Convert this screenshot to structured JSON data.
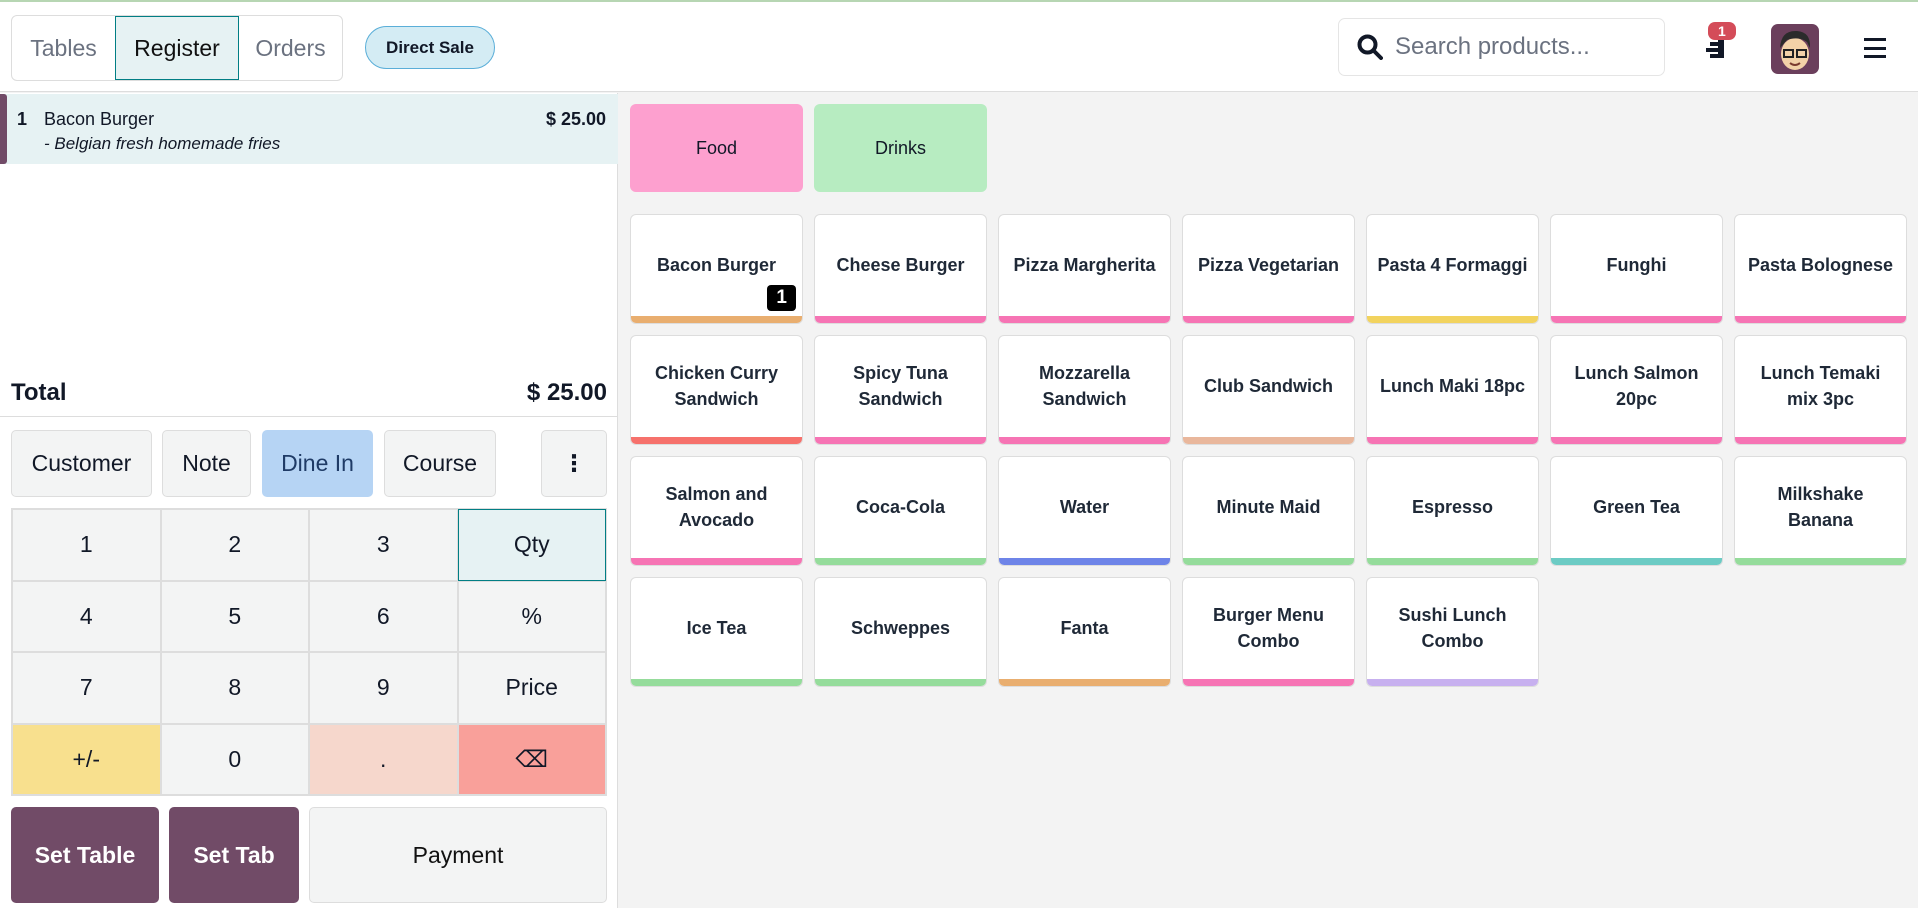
{
  "header": {
    "tabs": [
      {
        "label": "Tables"
      },
      {
        "label": "Register"
      },
      {
        "label": "Orders"
      }
    ],
    "direct_sale": "Direct Sale",
    "search_placeholder": "Search products...",
    "orders_badge": "1"
  },
  "order": {
    "lines": [
      {
        "qty": "1",
        "name": "Bacon Burger",
        "note": "- Belgian fresh homemade fries",
        "price": "$ 25.00"
      }
    ],
    "total_label": "Total",
    "total": "$ 25.00"
  },
  "controls": {
    "customer": "Customer",
    "note": "Note",
    "dine_in": "Dine In",
    "course": "Course",
    "more": "⋮"
  },
  "numpad": [
    "1",
    "2",
    "3",
    "Qty",
    "4",
    "5",
    "6",
    "%",
    "7",
    "8",
    "9",
    "Price",
    "+/-",
    "0",
    ".",
    "⌫"
  ],
  "actions": {
    "set_table": "Set Table",
    "set_tab": "Set Tab",
    "payment": "Payment"
  },
  "categories": [
    {
      "label": "Food",
      "color": "#fda0cf"
    },
    {
      "label": "Drinks",
      "color": "#b7ecc1"
    }
  ],
  "products": [
    {
      "name": "Bacon Burger",
      "color": "#e9ae6f",
      "count": "1"
    },
    {
      "name": "Cheese Burger",
      "color": "#f674b4"
    },
    {
      "name": "Pizza Margherita",
      "color": "#f674b4"
    },
    {
      "name": "Pizza Vegetarian",
      "color": "#f674b4"
    },
    {
      "name": "Pasta 4 Formaggi",
      "color": "#f2d35e"
    },
    {
      "name": "Funghi",
      "color": "#f674b4"
    },
    {
      "name": "Pasta Bolognese",
      "color": "#f674b4"
    },
    {
      "name": "Chicken Curry Sandwich",
      "color": "#f6716c"
    },
    {
      "name": "Spicy Tuna Sandwich",
      "color": "#f674b4"
    },
    {
      "name": "Mozzarella Sandwich",
      "color": "#f674b4"
    },
    {
      "name": "Club Sandwich",
      "color": "#e9b79c"
    },
    {
      "name": "Lunch Maki 18pc",
      "color": "#f674b4"
    },
    {
      "name": "Lunch Salmon 20pc",
      "color": "#f674b4"
    },
    {
      "name": "Lunch Temaki mix 3pc",
      "color": "#f674b4"
    },
    {
      "name": "Salmon and Avocado",
      "color": "#f674b4"
    },
    {
      "name": "Coca-Cola",
      "color": "#95dc9b"
    },
    {
      "name": "Water",
      "color": "#6e84e8"
    },
    {
      "name": "Minute Maid",
      "color": "#95dc9b"
    },
    {
      "name": "Espresso",
      "color": "#95dc9b"
    },
    {
      "name": "Green Tea",
      "color": "#6ccbc4"
    },
    {
      "name": "Milkshake Banana",
      "color": "#95dc9b"
    },
    {
      "name": "Ice Tea",
      "color": "#95dc9b"
    },
    {
      "name": "Schweppes",
      "color": "#95dc9b"
    },
    {
      "name": "Fanta",
      "color": "#e9ae6f"
    },
    {
      "name": "Burger Menu Combo",
      "color": "#f674b4"
    },
    {
      "name": "Sushi Lunch Combo",
      "color": "#c7b0ef"
    }
  ]
}
